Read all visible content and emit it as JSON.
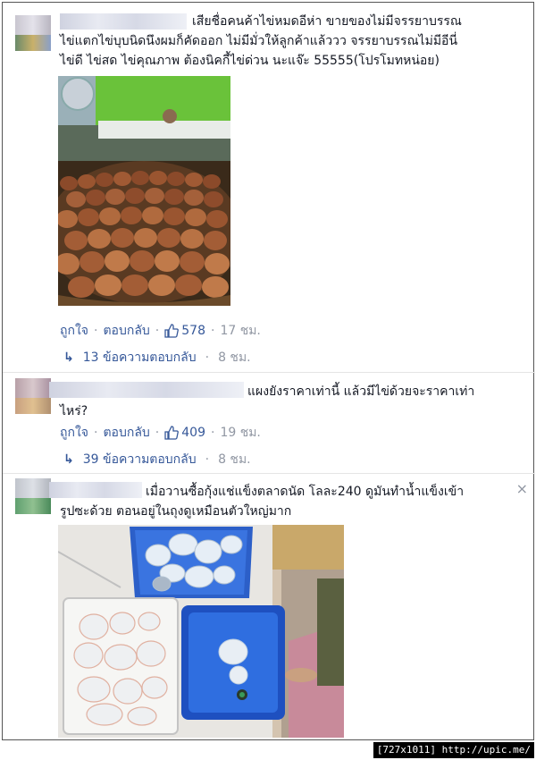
{
  "comments": [
    {
      "text_line1": "เสียชื่อคนค้าไข่หมดอีห่า ขายของไม่มีจรรยาบรรณ",
      "text_line2": "ไข่แตกไข่บุบนิดนึงผมก็คัดออก ไม่มีมั่วให้ลูกค้าแล้ววว จรรยาบรรณไม่มีอีนี่",
      "text_line3": "ไข่ดี ไข่สด ไข่คุณภาพ ต้องนิคกี้ไข่ด่วน นะแจ๊ะ 55555(โปรโมทหน่อย)",
      "like_label": "ถูกใจ",
      "reply_label": "ตอบกลับ",
      "likes": "578",
      "time": "17 ชม.",
      "replies_label": "13 ข้อความตอบกลับ",
      "replies_time": "8 ชม."
    },
    {
      "text_line1": "แผงยังราคาเท่านี้ แล้วมีไข่ด้วยจะราคาเท่า",
      "text_line2": "ไหร่?",
      "like_label": "ถูกใจ",
      "reply_label": "ตอบกลับ",
      "likes": "409",
      "time": "19 ชม.",
      "replies_label": "39 ข้อความตอบกลับ",
      "replies_time": "8 ชม."
    },
    {
      "text_line1": "เมื่อวานซื้อกุ้งแช่แข็งตลาดนัด โลละ240 ดูมันทำน้ำแข็งเข้า",
      "text_line2": "รูปซะด้วย ตอนอยู่ในถุงดูเหมือนตัวใหญ่มาก"
    }
  ],
  "close_symbol": "×",
  "reply_arrow": "↳",
  "separator": "·",
  "footer": "[727x1011] http://upic.me/",
  "colors": {
    "link": "#365899",
    "meta": "#9197a3",
    "text": "#141823"
  }
}
